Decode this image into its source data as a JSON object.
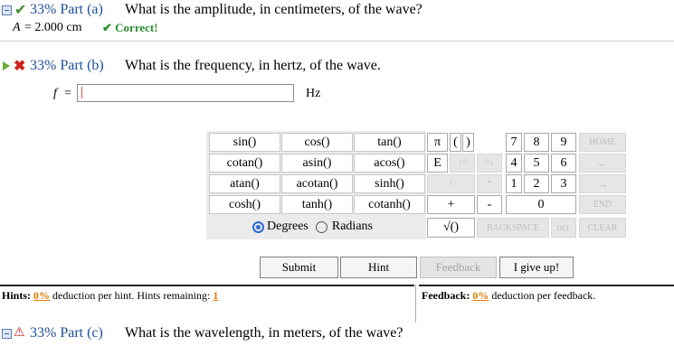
{
  "part_a": {
    "percent_label": "33% Part (a)",
    "question": "What is the amplitude, in centimeters, of the wave?",
    "answer_label": "A",
    "answer_text": "= 2.000 cm",
    "status": "Correct!"
  },
  "part_b": {
    "percent_label": "33% Part (b)",
    "question": "What is the frequency, in hertz, of the wave.",
    "variable": "f",
    "equals": "=",
    "input_value": "",
    "unit": "Hz"
  },
  "keypad": {
    "functions": [
      "sin()",
      "cos()",
      "tan()",
      "cotan()",
      "asin()",
      "acos()",
      "atan()",
      "acotan()",
      "sinh()",
      "cosh()",
      "tanh()",
      "cotanh()"
    ],
    "pi": "π",
    "open_paren": "(",
    "close_paren": ")",
    "e": "E",
    "up_caret": "↑^",
    "caret_down": "^↓",
    "slash": "/",
    "asterisk": "*",
    "plus": "+",
    "minus": "-",
    "sqrt": "√()",
    "digits": [
      "7",
      "8",
      "9",
      "4",
      "5",
      "6",
      "1",
      "2",
      "3",
      "0",
      "."
    ],
    "home": "HOME",
    "left_arrow": "←",
    "right_arrow": "→",
    "end": "END",
    "backspace": "BACKSPACE",
    "del": "DEL",
    "clear": "CLEAR",
    "degrees": "Degrees",
    "radians": "Radians"
  },
  "actions": {
    "submit": "Submit",
    "hint": "Hint",
    "feedback": "Feedback",
    "give_up": "I give up!"
  },
  "hints": {
    "label": "Hints:",
    "percent": "0%",
    "text": "deduction per hint. Hints remaining:",
    "remaining": "1"
  },
  "feedback": {
    "label": "Feedback:",
    "percent": "0%",
    "text": "deduction per feedback."
  },
  "part_c": {
    "percent_label": "33% Part (c)",
    "question": "What is the wavelength, in meters, of the wave?"
  }
}
